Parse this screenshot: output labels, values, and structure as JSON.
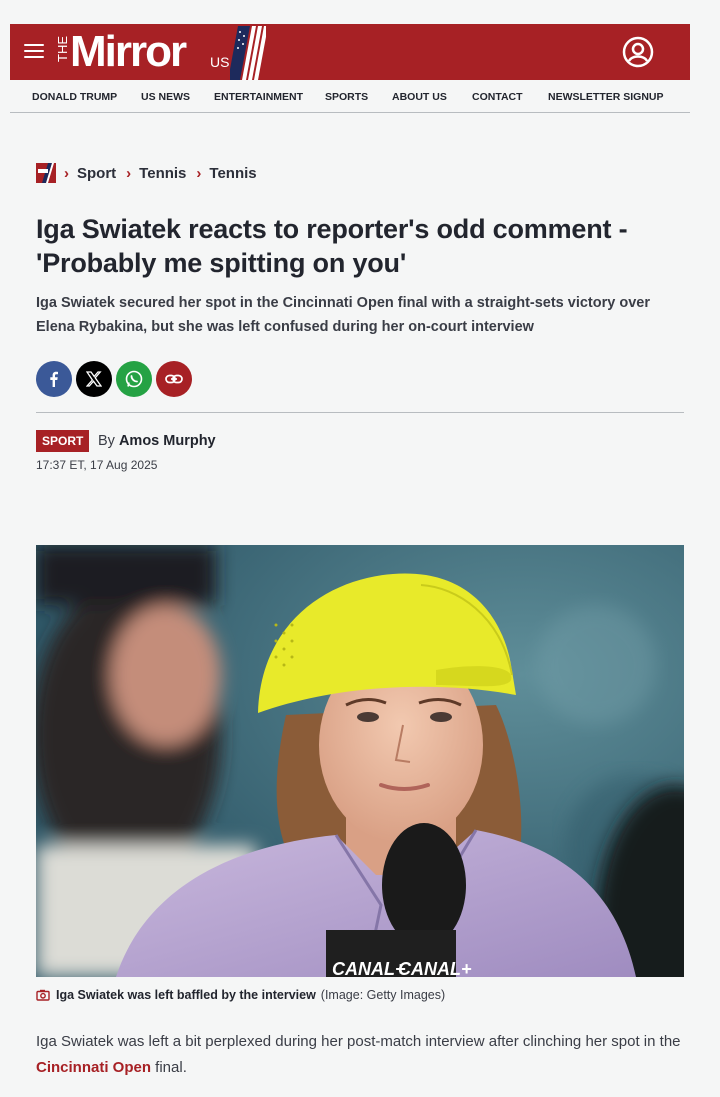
{
  "header": {
    "logo_the": "THE",
    "logo_main": "Mirror",
    "logo_us": "US",
    "nav": [
      {
        "label": "DONALD TRUMP"
      },
      {
        "label": "US NEWS"
      },
      {
        "label": "ENTERTAINMENT"
      },
      {
        "label": "SPORTS"
      },
      {
        "label": "ABOUT US"
      },
      {
        "label": "CONTACT"
      },
      {
        "label": "NEWSLETTER SIGNUP"
      }
    ]
  },
  "breadcrumb": [
    "Sport",
    "Tennis",
    "Tennis"
  ],
  "article": {
    "headline": "Iga Swiatek reacts to reporter's odd comment - 'Probably me spitting on you'",
    "standfirst": "Iga Swiatek secured her spot in the Cincinnati Open final with a straight-sets victory over Elena Rybakina, but she was left confused during her on-court interview",
    "section_badge": "SPORT",
    "by_prefix": "By",
    "author": "Amos Murphy",
    "timestamp": "17:37 ET, 17 Aug 2025",
    "image_caption": "Iga Swiatek was left baffled by the interview",
    "image_credit": "(Image: Getty Images)",
    "microphone_text": "CANAL+",
    "body_p1_before": "Iga Swiatek was left a bit perplexed during her post-match interview after clinching her spot in the ",
    "body_p1_link": "Cincinnati Open",
    "body_p1_after": " final."
  },
  "share_buttons": [
    {
      "icon": "facebook-icon",
      "color": "#3b5998"
    },
    {
      "icon": "x-icon",
      "color": "#000000"
    },
    {
      "icon": "whatsapp-icon",
      "color": "#25a244"
    },
    {
      "icon": "link-icon",
      "color": "#a72125"
    }
  ],
  "colors": {
    "brand_red": "#a72125",
    "background": "#f5f6f6",
    "text": "#22252e"
  }
}
